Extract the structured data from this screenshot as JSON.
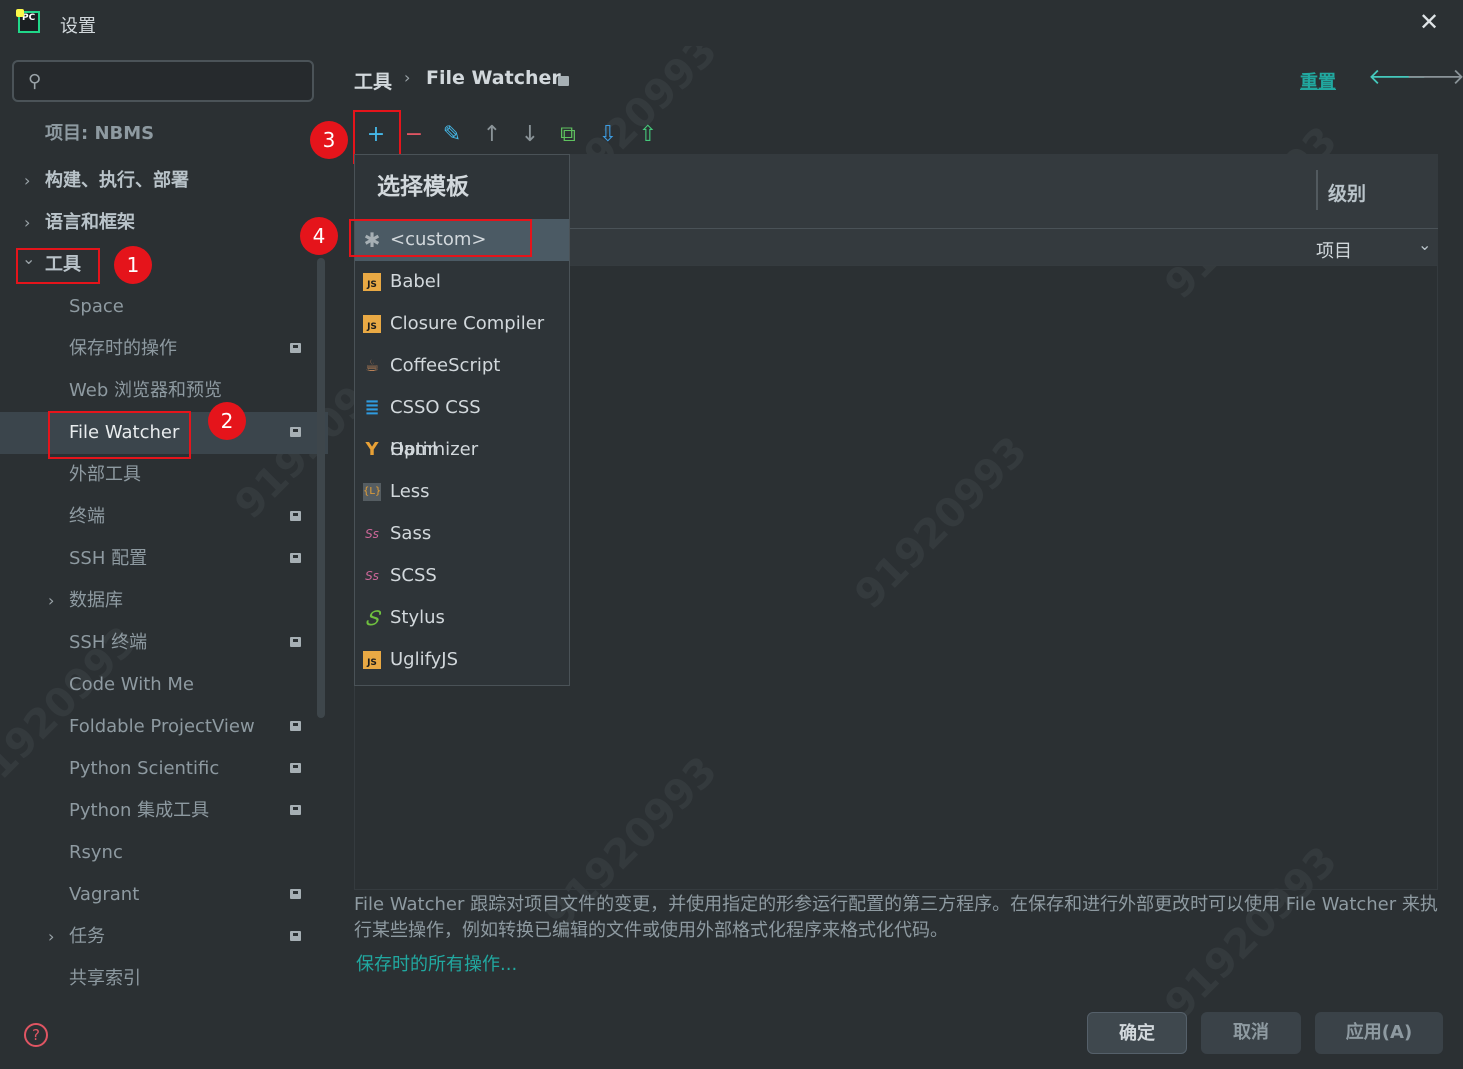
{
  "window": {
    "title": "设置",
    "close_glyph": "✕"
  },
  "sidebar": {
    "search_placeholder": "",
    "project_label": "项目: NBMS",
    "items": [
      {
        "label": "构建、执行、部署",
        "chevron": "›"
      },
      {
        "label": "语言和框架",
        "chevron": "›"
      },
      {
        "label": "工具",
        "chevron": "⌄"
      },
      {
        "label": "Space"
      },
      {
        "label": "保存时的操作"
      },
      {
        "label": "Web 浏览器和预览"
      },
      {
        "label": "File Watcher"
      },
      {
        "label": "外部工具"
      },
      {
        "label": "终端"
      },
      {
        "label": "SSH 配置"
      },
      {
        "label": "数据库",
        "chevron": "›"
      },
      {
        "label": "SSH 终端"
      },
      {
        "label": "Code With Me"
      },
      {
        "label": "Foldable ProjectView"
      },
      {
        "label": "Python Scientific"
      },
      {
        "label": "Python 集成工具"
      },
      {
        "label": "Rsync"
      },
      {
        "label": "Vagrant"
      },
      {
        "label": "任务",
        "chevron": "›"
      },
      {
        "label": "共享索引"
      }
    ]
  },
  "breadcrumb": {
    "parent": "工具",
    "separator": "›",
    "current": "File Watcher"
  },
  "reset_label": "重置",
  "nav_icons": {
    "back": "back-arrow-icon",
    "forward": "forward-arrow-icon"
  },
  "toolbar": {
    "add": "+",
    "remove": "−",
    "edit": "✎",
    "up": "↑",
    "down": "↓",
    "copy": "⧉",
    "import": "⇩",
    "export": "⇧"
  },
  "table": {
    "col_level": "级别",
    "row_scope": "项目"
  },
  "popup": {
    "title": "选择模板",
    "items": [
      {
        "label": "<custom>",
        "icon": "asterisk-icon"
      },
      {
        "label": "Babel",
        "icon": "js-icon"
      },
      {
        "label": "Closure Compiler",
        "icon": "js-icon"
      },
      {
        "label": "CoffeeScript",
        "icon": "coffee-icon"
      },
      {
        "label": "CSSO CSS Optimizer",
        "icon": "css-icon"
      },
      {
        "label": "Haml",
        "icon": "haml-icon"
      },
      {
        "label": "Less",
        "icon": "less-icon"
      },
      {
        "label": "Sass",
        "icon": "sass-icon"
      },
      {
        "label": "SCSS",
        "icon": "sass-icon"
      },
      {
        "label": "Stylus",
        "icon": "stylus-icon"
      },
      {
        "label": "UglifyJS",
        "icon": "js-icon"
      }
    ]
  },
  "description": "File Watcher 跟踪对项目文件的变更，并使用指定的形参运行配置的第三方程序。在保存和进行外部更改时可以使用 File Watcher 来执行某些操作，例如转换已编辑的文件或使用外部格式化程序来格式化代码。",
  "description_link": "保存时的所有操作...",
  "buttons": {
    "ok": "确定",
    "cancel": "取消",
    "apply": "应用(A)"
  },
  "help_glyph": "?",
  "annotations": [
    "1",
    "2",
    "3",
    "4"
  ],
  "watermark": "91920993",
  "colors": {
    "accent": "#21a8a0",
    "annotation": "#e5141b",
    "background": "#2b3033"
  }
}
